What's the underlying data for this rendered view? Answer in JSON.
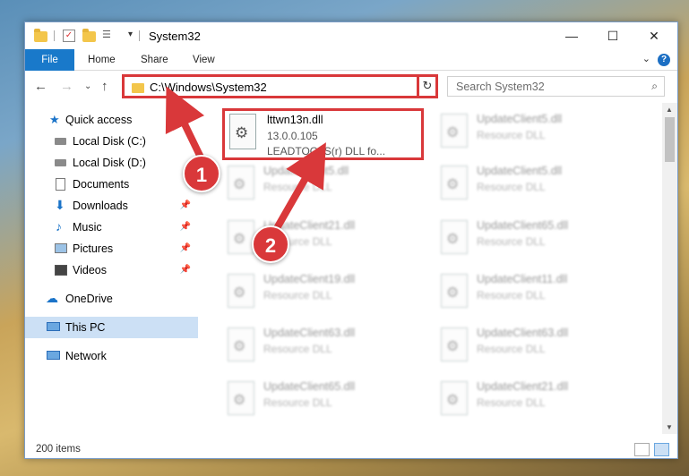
{
  "window": {
    "title": "System32",
    "controls": [
      "—",
      "☐",
      "✕"
    ]
  },
  "ribbon": {
    "tabs": [
      "File",
      "Home",
      "Share",
      "View"
    ],
    "help_label": "?"
  },
  "nav": {
    "address": "C:\\Windows\\System32",
    "search_placeholder": "Search System32"
  },
  "sidebar": {
    "items": [
      {
        "label": "Quick access",
        "icon": "star-icon"
      },
      {
        "label": "Local Disk (C:)",
        "icon": "drive-icon"
      },
      {
        "label": "Local Disk (D:)",
        "icon": "drive-icon"
      },
      {
        "label": "Documents",
        "icon": "documents-icon"
      },
      {
        "label": "Downloads",
        "icon": "downloads-icon"
      },
      {
        "label": "Music",
        "icon": "music-icon"
      },
      {
        "label": "Pictures",
        "icon": "pictures-icon"
      },
      {
        "label": "Videos",
        "icon": "videos-icon"
      },
      {
        "label": "OneDrive",
        "icon": "cloud-icon"
      },
      {
        "label": "This PC",
        "icon": "computer-icon"
      },
      {
        "label": "Network",
        "icon": "network-icon"
      }
    ],
    "pinned_marker": "📌"
  },
  "files": {
    "highlighted": {
      "name": "lttwn13n.dll",
      "version": "13.0.0.105",
      "description": "LEADTOOLS(r) DLL fo..."
    },
    "tiles": [
      {
        "name": "UpdateClient5.dll",
        "desc": "Resource DLL"
      },
      {
        "name": "UpdateClient5.dll",
        "desc": "Resource DLL"
      },
      {
        "name": "UpdateClient5.dll",
        "desc": "Resource DLL"
      },
      {
        "name": "UpdateClient21.dll",
        "desc": "Resource DLL"
      },
      {
        "name": "UpdateClient65.dll",
        "desc": "Resource DLL"
      },
      {
        "name": "UpdateClient19.dll",
        "desc": "Resource DLL"
      },
      {
        "name": "UpdateClient11.dll",
        "desc": "Resource DLL"
      },
      {
        "name": "UpdateClient63.dll",
        "desc": "Resource DLL"
      },
      {
        "name": "UpdateClient63.dll",
        "desc": "Resource DLL"
      },
      {
        "name": "UpdateClient65.dll",
        "desc": "Resource DLL"
      },
      {
        "name": "UpdateClient21.dll",
        "desc": "Resource DLL"
      }
    ]
  },
  "status": {
    "item_count": "200 items"
  },
  "callouts": [
    "1",
    "2"
  ],
  "colors": {
    "accent": "#1979ca",
    "highlight_red": "#d9383a",
    "selected_bg": "#cce0f5"
  }
}
